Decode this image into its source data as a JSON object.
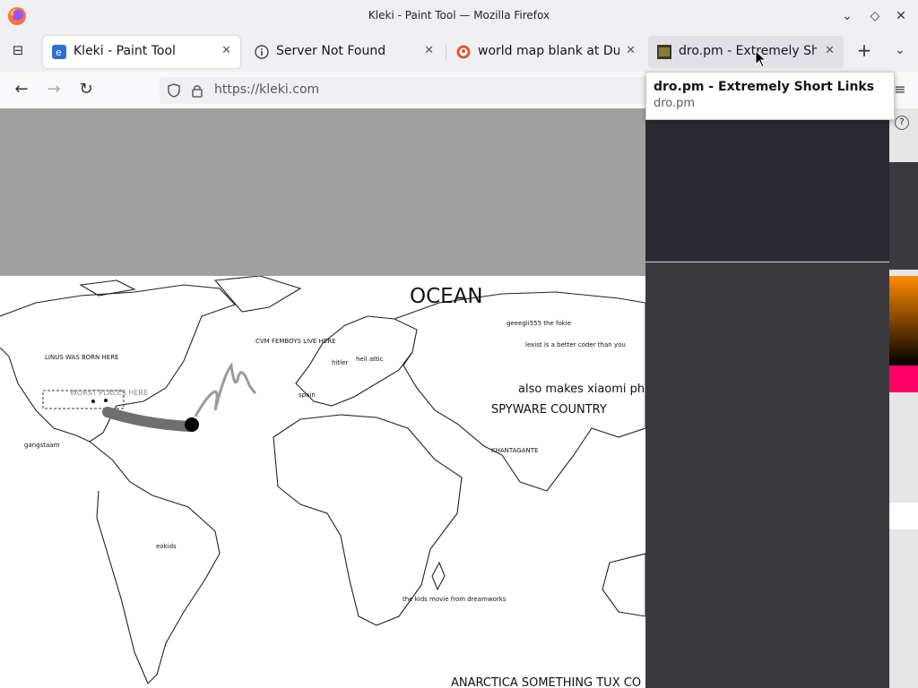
{
  "window": {
    "title": "Kleki - Paint Tool — Mozilla Firefox"
  },
  "tabs": [
    {
      "label": "Kleki - Paint Tool",
      "icon": "kleki-favicon",
      "active": true
    },
    {
      "label": "Server Not Found",
      "icon": "info-icon"
    },
    {
      "label": "world map blank at Duck",
      "icon": "duckduckgo-favicon"
    },
    {
      "label": "dro.pm - Extremely Sho",
      "icon": "dropm-favicon",
      "hovered": true
    }
  ],
  "tooltip": {
    "title": "dro.pm - Extremely Short Links",
    "url": "dro.pm"
  },
  "address": {
    "url": "https://kleki.com"
  },
  "map_labels": {
    "ocean": "OCEAN",
    "linus": "LINUS WAS BORN HERE",
    "worst_place": "WORST PLACES HERE",
    "cvm": "CVM FEMBOYS LIVE HERE",
    "geegi": "geeegii555 the fokie",
    "lexist": "lexist is a better coder than you",
    "spain": "spain",
    "also": "also makes xiaomi ph",
    "spyware": "SPYWARE COUNTRY",
    "khantagante": "KHANTAGANTE",
    "eokids": "eokids",
    "kids_movie": "the kids movie from dreamworks",
    "antarctica": "ANARCTICA SOMETHING TUX CO",
    "hitler": "hitler",
    "heil": "heil attic",
    "gangstaam": "gangstaam"
  },
  "colors": {
    "panel": "#3a3a3e",
    "canvas_bg": "#a0a0a0",
    "accent_orange": "#ff8a00",
    "accent_pink": "#ff0066"
  }
}
